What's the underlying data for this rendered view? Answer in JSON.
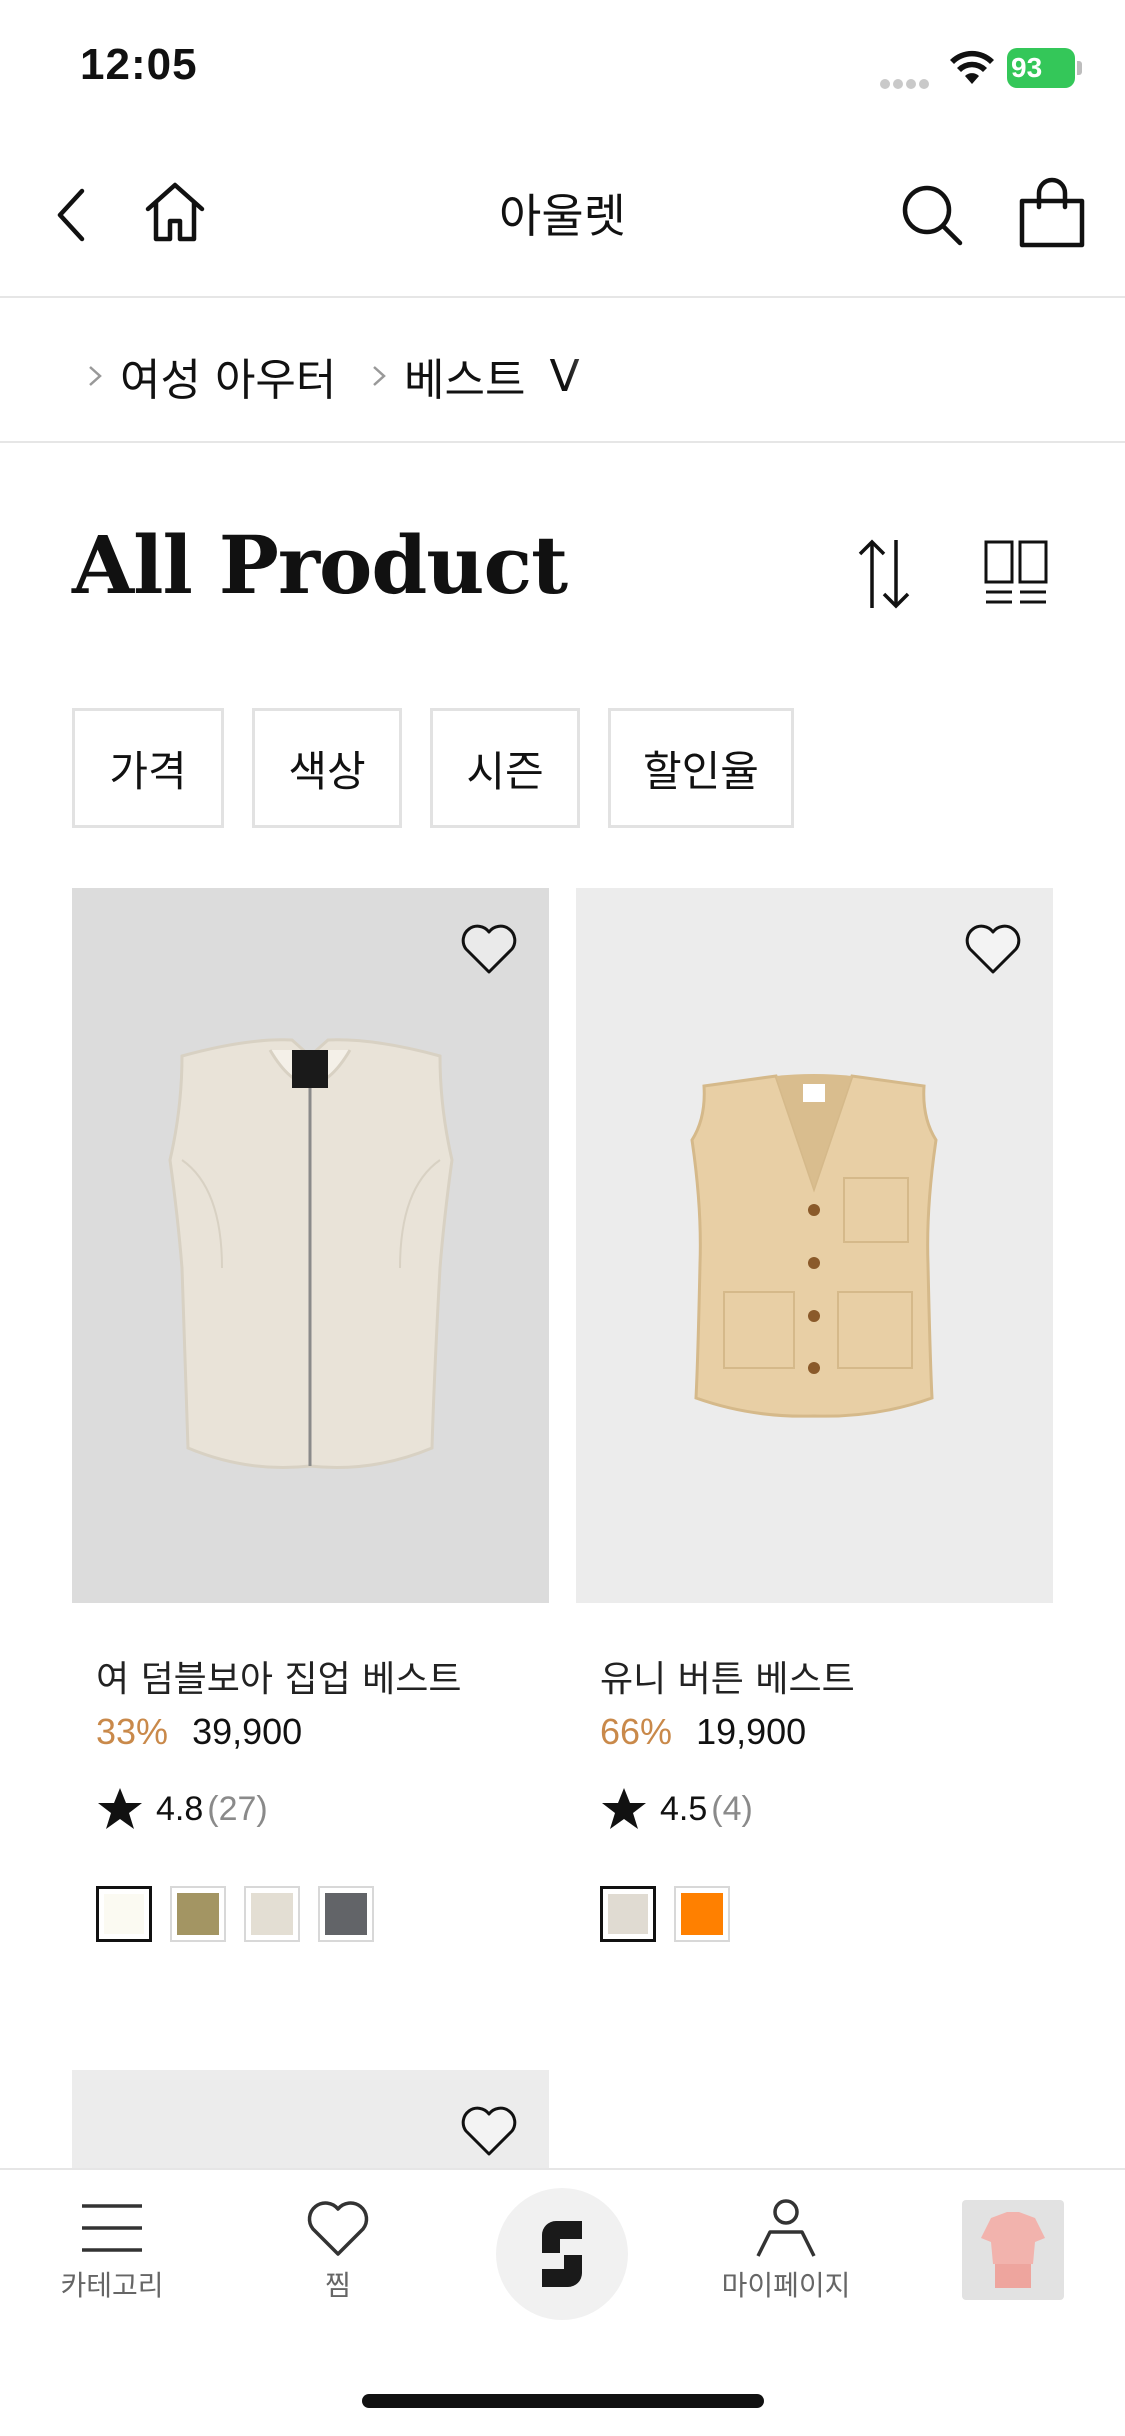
{
  "status_bar": {
    "time": "12:05",
    "battery": "93"
  },
  "header": {
    "title": "아울렛"
  },
  "breadcrumb": [
    "여성 아우터",
    "베스트",
    "V"
  ],
  "page_title": "All Product",
  "filters": [
    "가격",
    "색상",
    "시즌",
    "할인율"
  ],
  "products": [
    {
      "name": "여 덤블보아 집업 베스트",
      "discount": "33%",
      "price": "39,900",
      "rating": "4.8",
      "reviews": "(27)",
      "swatches": [
        "#fbfaf2",
        "#a39563",
        "#e3ded3",
        "#626468"
      ]
    },
    {
      "name": "유니 버튼 베스트",
      "discount": "66%",
      "price": "19,900",
      "rating": "4.5",
      "reviews": "(4)",
      "swatches": [
        "#e0dbd2",
        "#ff8000"
      ]
    }
  ],
  "tab_bar": {
    "category": "카테고리",
    "wishlist": "찜",
    "mypage": "마이페이지"
  },
  "colors": {
    "discount": "#c9894a",
    "battery": "#34c759",
    "border": "#e2e2e2"
  },
  "icons": [
    "back-icon",
    "home-icon",
    "search-icon",
    "shopping-bag-icon",
    "sort-icon",
    "grid-view-icon",
    "heart-icon",
    "star-icon",
    "menu-icon",
    "user-icon",
    "brand-logo-icon"
  ]
}
